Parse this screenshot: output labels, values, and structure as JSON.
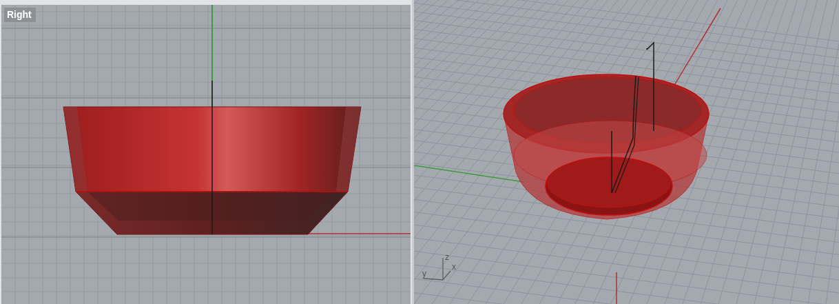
{
  "viewports": [
    {
      "kind": "ortho",
      "label": "Right",
      "selected": true
    },
    {
      "kind": "perspective",
      "axis_labels": [
        "z",
        "y",
        "x"
      ],
      "selected": false
    }
  ]
}
